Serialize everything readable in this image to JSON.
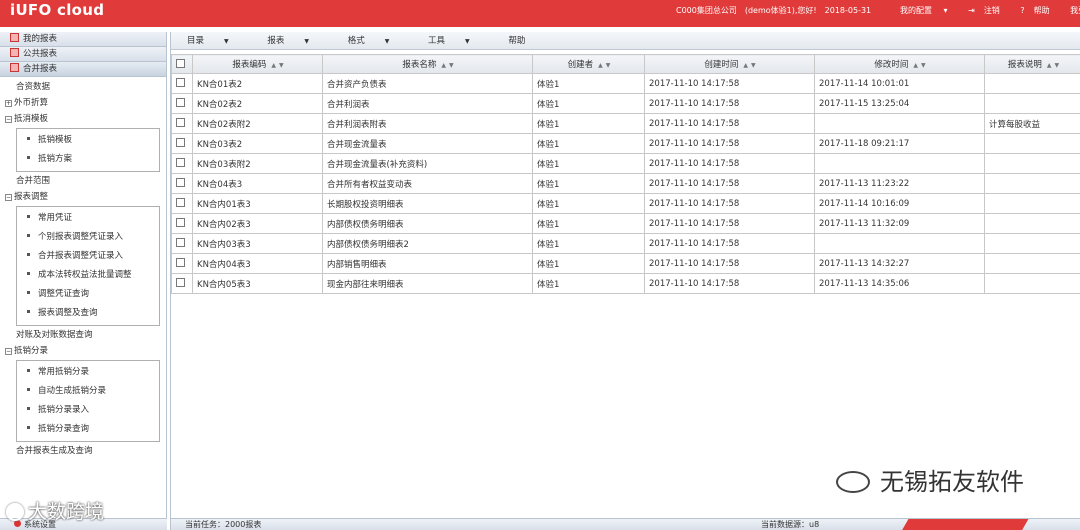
{
  "header": {
    "logo": "iUFO cloud",
    "company": "C000集团总公司",
    "user_greeting": "(demo体验1),您好!",
    "date": "2018-05-31",
    "nav": [
      "我的配置",
      "注销",
      "帮助",
      "我要转UC"
    ],
    "accent": "#e03a3a"
  },
  "left_panel": {
    "sections": [
      "我的报表",
      "公共报表",
      "合并报表"
    ],
    "tree": {
      "item_1": "合资数据",
      "item_2": "外币折算",
      "group_1": "抵消模板",
      "group_1_items": [
        "抵销模板",
        "抵销方案"
      ],
      "item_3": "合并范围",
      "group_2": "报表调整",
      "group_2_items": [
        "常用凭证",
        "个别报表调整凭证录入",
        "合并报表调整凭证录入",
        "成本法转权益法批量调整",
        "调整凭证查询",
        "报表调整及查询"
      ],
      "item_4": "对账及对账数据查询",
      "group_3": "抵销分录",
      "group_3_items": [
        "常用抵销分录",
        "自动生成抵销分录",
        "抵销分录录入",
        "抵销分录查询"
      ],
      "item_5": "合并报表生成及查询"
    },
    "footer": "系统设置"
  },
  "menubar": [
    "目录",
    "报表",
    "格式",
    "工具",
    "帮助"
  ],
  "table": {
    "columns": [
      "报表编码",
      "报表名称",
      "创建者",
      "创建时间",
      "修改时间",
      "报表说明"
    ],
    "rows": [
      [
        "KN合01表2",
        "合并资产负债表",
        "体验1",
        "2017-11-10 14:17:58",
        "2017-11-14 10:01:01",
        ""
      ],
      [
        "KN合02表2",
        "合并利润表",
        "体验1",
        "2017-11-10 14:17:58",
        "2017-11-15 13:25:04",
        ""
      ],
      [
        "KN合02表附2",
        "合并利润表附表",
        "体验1",
        "2017-11-10 14:17:58",
        "",
        "计算每股收益"
      ],
      [
        "KN合03表2",
        "合并现金流量表",
        "体验1",
        "2017-11-10 14:17:58",
        "2017-11-18 09:21:17",
        ""
      ],
      [
        "KN合03表附2",
        "合并现金流量表(补充资料)",
        "体验1",
        "2017-11-10 14:17:58",
        "",
        ""
      ],
      [
        "KN合04表3",
        "合并所有者权益变动表",
        "体验1",
        "2017-11-10 14:17:58",
        "2017-11-13 11:23:22",
        ""
      ],
      [
        "KN合内01表3",
        "长期股权投资明细表",
        "体验1",
        "2017-11-10 14:17:58",
        "2017-11-14 10:16:09",
        ""
      ],
      [
        "KN合内02表3",
        "内部债权债务明细表",
        "体验1",
        "2017-11-10 14:17:58",
        "2017-11-13 11:32:09",
        ""
      ],
      [
        "KN合内03表3",
        "内部债权债务明细表2",
        "体验1",
        "2017-11-10 14:17:58",
        "",
        ""
      ],
      [
        "KN合内04表3",
        "内部销售明细表",
        "体验1",
        "2017-11-10 14:17:58",
        "2017-11-13 14:32:27",
        ""
      ],
      [
        "KN合内05表3",
        "现金内部往来明细表",
        "体验1",
        "2017-11-10 14:17:58",
        "2017-11-13 14:35:06",
        ""
      ]
    ]
  },
  "status": {
    "task": "当前任务：2000报表",
    "datasource": "当前数据源：u8"
  },
  "watermarks": {
    "right": "无锡拓友软件",
    "left": "大数跨境"
  }
}
